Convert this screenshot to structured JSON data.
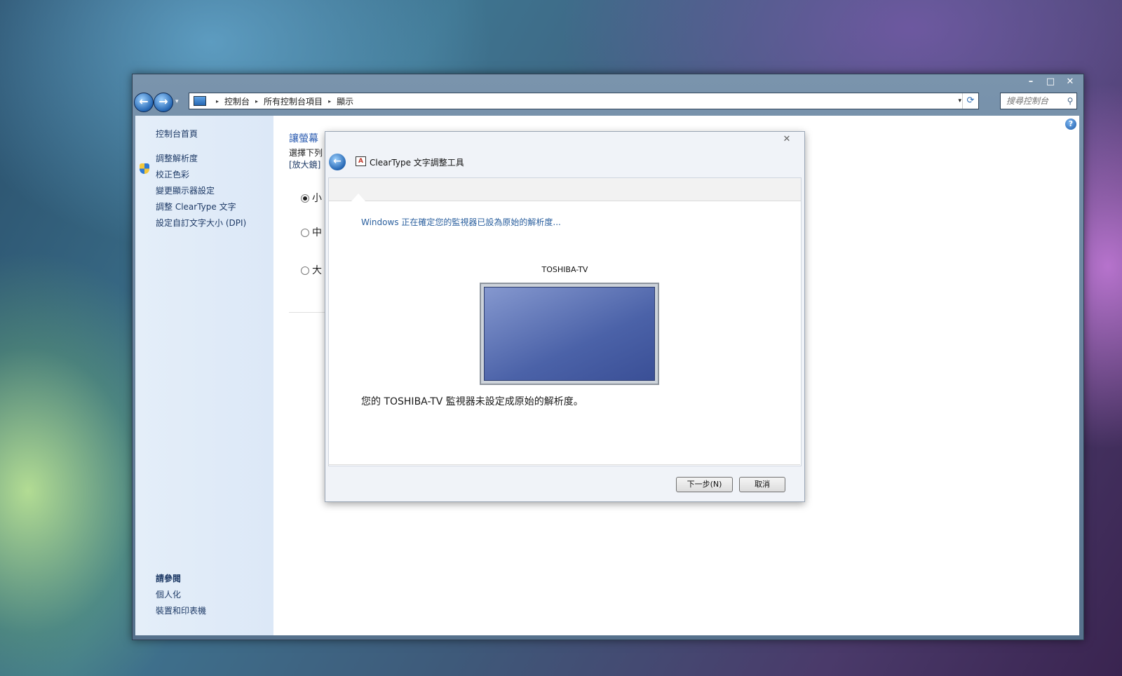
{
  "window": {
    "caption_min": "–",
    "caption_max": "□",
    "caption_close": "✕"
  },
  "nav": {
    "back_glyph": "←",
    "forward_glyph": "→",
    "dropdown_glyph": "▾",
    "breadcrumb": [
      "控制台",
      "所有控制台項目",
      "顯示"
    ],
    "sep_glyph": "▸",
    "refresh_glyph": "⟳",
    "search_placeholder": "搜尋控制台",
    "search_glyph": "⚲"
  },
  "sidebar": {
    "home": "控制台首頁",
    "links": [
      "調整解析度",
      "校正色彩",
      "變更顯示器設定",
      "調整 ClearType 文字",
      "設定自訂文字大小 (DPI)"
    ],
    "see_also_title": "請參閱",
    "see_also": [
      "個人化",
      "裝置和印表機"
    ]
  },
  "content": {
    "title_visible": "讓螢幕",
    "line_visible": "選擇下列",
    "link_visible": "[放大鏡]",
    "options": [
      "小",
      "中",
      "大"
    ],
    "selected_option": 0,
    "help_glyph": "?"
  },
  "dialog": {
    "close_glyph": "✕",
    "back_glyph": "←",
    "app_icon_glyph": "A",
    "title": "ClearType 文字調整工具",
    "status": "Windows 正在確定您的監視器已設為原始的解析度...",
    "monitor_name": "TOSHIBA-TV",
    "message": "您的 TOSHIBA-TV 監視器未設定成原始的解析度。",
    "next_label": "下一步(N)",
    "cancel_label": "取消"
  }
}
